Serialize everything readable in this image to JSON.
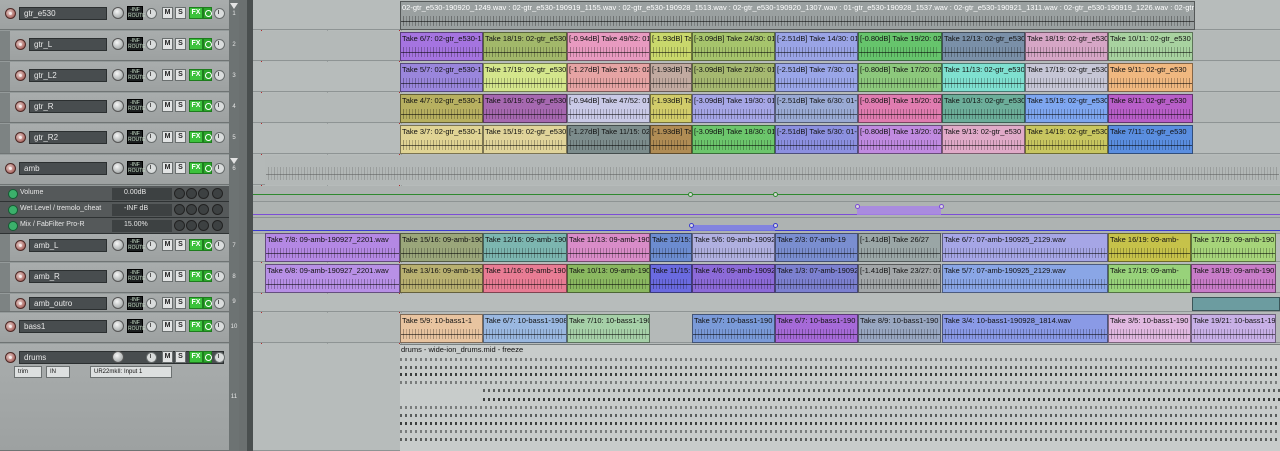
{
  "tracks": [
    {
      "name": "gtr_e530",
      "num": "1",
      "type": "folder"
    },
    {
      "name": "gtr_L",
      "num": "2"
    },
    {
      "name": "gtr_L2",
      "num": "3"
    },
    {
      "name": "gtr_R",
      "num": "4"
    },
    {
      "name": "gtr_R2",
      "num": "5"
    },
    {
      "name": "amb",
      "num": "6",
      "type": "folder"
    },
    {
      "name": "amb_L",
      "num": "7"
    },
    {
      "name": "amb_R",
      "num": "8"
    },
    {
      "name": "amb_outro",
      "num": "9"
    },
    {
      "name": "bass1",
      "num": "10"
    },
    {
      "name": "drums",
      "num": "11"
    }
  ],
  "meter": {
    "top": "-INF",
    "bottom": "ROUTE"
  },
  "buttons": {
    "mute": "M",
    "solo": "S",
    "fx": "FX"
  },
  "envelopes": [
    {
      "name": "Volume",
      "value": "0.00dB"
    },
    {
      "name": "Wet Level / tremolo_cheat",
      "value": "-INF dB"
    },
    {
      "name": "Mix / FabFilter Pro-R",
      "value": "15.00%"
    }
  ],
  "drums_io": {
    "trim": "trim",
    "in": "IN",
    "input": "UR22mkII: Input 1"
  },
  "folder_item": "02-gtr_e530-190920_1249.wav : 02-gtr_e530-190919_1155.wav : 02-gtr_e530-190928_1513.wav : 02-gtr_e530-190920_1307.wav : 01-gtr_e530-190928_1537.wav : 02-gtr_e530-190921_1311.wav : 02-gtr_e530-190919_1226.wav : 02-gtr_e5",
  "gtr_rows": [
    [
      "Take 6/7: 02-gtr_e530-190",
      "Take 18/19: 02-gtr_e530",
      "[-0.94dB] Take 49/52: 01",
      "[-1.93dB] Ta",
      "[-3.09dB] Take 24/30: 01",
      "[-2.51dB] Take 14/30: 01",
      "[-0.80dB] Take 19/20: 02",
      "Take 12/13: 02-gtr_e530",
      "Take 18/19: 02-gtr_e530",
      "Take 10/11: 02-gtr_e530"
    ],
    [
      "Take 5/7: 02-gtr_e530-190",
      "Take 17/19: 02-gtr_e530",
      "[-1.27dB] Take 13/15: 02",
      "[-1.93dB] Ta",
      "[-3.09dB] Take 21/30: 01",
      "[-2.51dB] Take 7/30: 01-",
      "[-0.80dB] Take 17/20: 02",
      "Take 11/13: 02-gtr_e530",
      "Take 17/19: 02-gtr_e530",
      "Take 9/11: 02-gtr_e530"
    ],
    [
      "Take 4/7: 02-gtr_e530-190",
      "Take 16/19: 02-gtr_e530",
      "[-0.94dB] Take 47/52: 01",
      "[-1.93dB] Ta",
      "[-3.09dB] Take 19/30: 01",
      "[-2.51dB] Take 6/30: 01-",
      "[-0.80dB] Take 15/20: 02",
      "Take 10/13: 02-gtr_e530",
      "Take 15/19: 02-gtr_e530",
      "Take 8/11: 02-gtr_e530"
    ],
    [
      "Take 3/7: 02-gtr_e530-190",
      "Take 15/19: 02-gtr_e530",
      "[-1.27dB] Take 11/15: 02",
      "[-1.93dB] Ta",
      "[-3.09dB] Take 18/30: 01",
      "[-2.51dB] Take 5/30: 01-",
      "[-0.80dB] Take 13/20: 02",
      "Take 9/13: 02-gtr_e530",
      "Take 14/19: 02-gtr_e530",
      "Take 7/11: 02-gtr_e530"
    ]
  ],
  "amb_L_items": [
    "Take 7/8: 09-amb-190927_2201.wav",
    "Take 15/16: 09-amb-190",
    "Take 12/16: 09-amb-190",
    "Take 11/13: 09-amb-190",
    "Take 12/15:",
    "Take 5/6: 09-amb-19092",
    "Take 2/3: 07-amb-19",
    "[-1.41dB] Take 26/27",
    "Take 6/7: 07-amb-190925_2129.wav",
    "Take 16/19: 09-amb-",
    "Take 17/19: 09-amb-190"
  ],
  "amb_R_items": [
    "Take 6/8: 09-amb-190927_2201.wav",
    "Take 13/16: 09-amb-190",
    "Take 11/16: 09-amb-190",
    "Take 10/13: 09-amb-190",
    "Take 11/15:",
    "Take 4/6: 09-amb-19092",
    "Take 1/3: 07-amb-19092",
    "[-1.41dB] Take 23/27: 07",
    "Take 5/7: 07-amb-190925_2129.wav",
    "Take 17/19: 09-amb-",
    "Take 18/19: 09-amb-190"
  ],
  "bass_items": [
    "Take 5/9: 10-bass1-1",
    "Take 6/7: 10-bass1-1908",
    "Take 7/10: 10-bass1-190",
    "Take 5/7: 10-bass1-190",
    "Take 6/7: 10-bass1-190",
    "Take 8/9: 10-bass1-190",
    "Take 3/4: 10-bass1-190928_1814.wav",
    "Take 3/5: 10-bass1-190",
    "Take 19/21: 10-bass1-19"
  ],
  "drums_item": "drums - wide-ion_drums.mid - freeze",
  "colors": {
    "accent_green": "#3cc23c",
    "playhead": "#b0282b",
    "env_volume": "#2f8a2f",
    "env_wet": "#7c4dd6",
    "env_mix": "#3a3ad0"
  }
}
